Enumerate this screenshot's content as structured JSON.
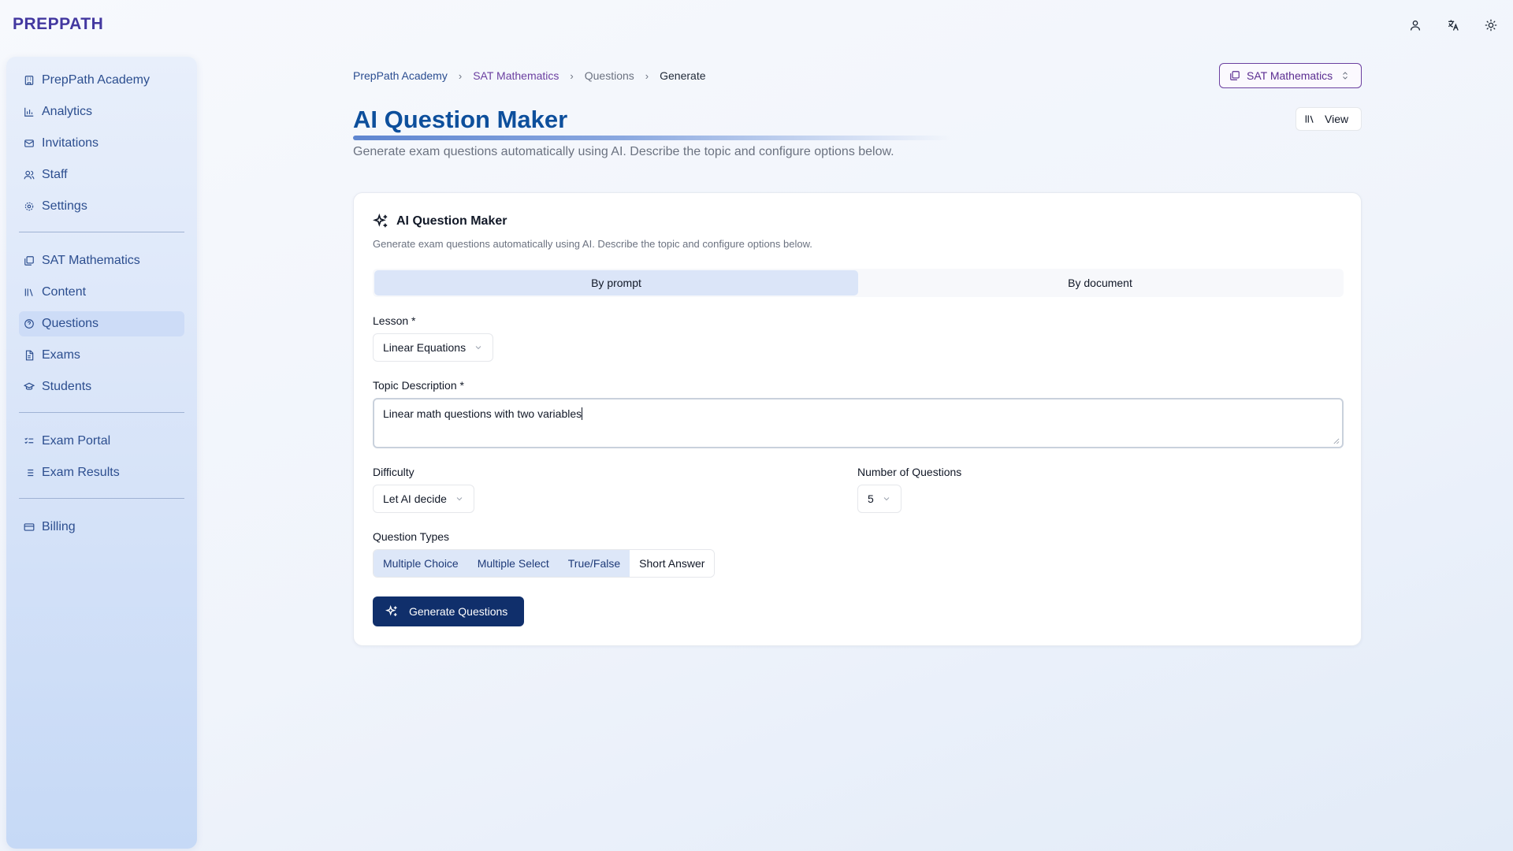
{
  "app": {
    "logo": "PREPPATH"
  },
  "topbar": {
    "icons": [
      "user-icon",
      "translate-icon",
      "sun-icon"
    ]
  },
  "sidebar": {
    "groups": [
      [
        {
          "label": "PrepPath Academy",
          "icon": "building-icon"
        },
        {
          "label": "Analytics",
          "icon": "bar-chart-icon"
        },
        {
          "label": "Invitations",
          "icon": "mail-icon"
        },
        {
          "label": "Staff",
          "icon": "users-icon"
        },
        {
          "label": "Settings",
          "icon": "gear-icon"
        }
      ],
      [
        {
          "label": "SAT Mathematics",
          "icon": "layers-icon"
        },
        {
          "label": "Content",
          "icon": "library-icon"
        },
        {
          "label": "Questions",
          "icon": "help-circle-icon",
          "active": true
        },
        {
          "label": "Exams",
          "icon": "document-icon"
        },
        {
          "label": "Students",
          "icon": "graduation-cap-icon"
        }
      ],
      [
        {
          "label": "Exam Portal",
          "icon": "checklist-icon"
        },
        {
          "label": "Exam Results",
          "icon": "list-icon"
        }
      ],
      [
        {
          "label": "Billing",
          "icon": "credit-card-icon"
        }
      ]
    ]
  },
  "breadcrumb": [
    "PrepPath Academy",
    "SAT Mathematics",
    "Questions",
    "Generate"
  ],
  "course_switcher": {
    "label": "SAT Mathematics"
  },
  "view_button": {
    "label": "View"
  },
  "page": {
    "title": "AI Question Maker",
    "subtitle": "Generate exam questions automatically using AI. Describe the topic and configure options below."
  },
  "card": {
    "title": "AI Question Maker",
    "subtitle": "Generate exam questions automatically using AI. Describe the topic and configure options below.",
    "tabs": {
      "prompt": "By prompt",
      "document": "By document",
      "active": "prompt"
    },
    "lesson": {
      "label": "Lesson *",
      "value": "Linear Equations"
    },
    "topic": {
      "label": "Topic Description *",
      "value": "Linear math questions with two variables"
    },
    "difficulty": {
      "label": "Difficulty",
      "value": "Let AI decide"
    },
    "count": {
      "label": "Number of Questions",
      "value": "5"
    },
    "types": {
      "label": "Question Types",
      "options": [
        {
          "label": "Multiple Choice",
          "selected": true
        },
        {
          "label": "Multiple Select",
          "selected": true
        },
        {
          "label": "True/False",
          "selected": true
        },
        {
          "label": "Short Answer",
          "selected": false
        }
      ]
    },
    "generate_label": "Generate Questions"
  },
  "colors": {
    "brand": "#4338a0",
    "primary": "#102f6b",
    "title": "#0d4f9c",
    "accent_purple": "#6b3fa0"
  }
}
